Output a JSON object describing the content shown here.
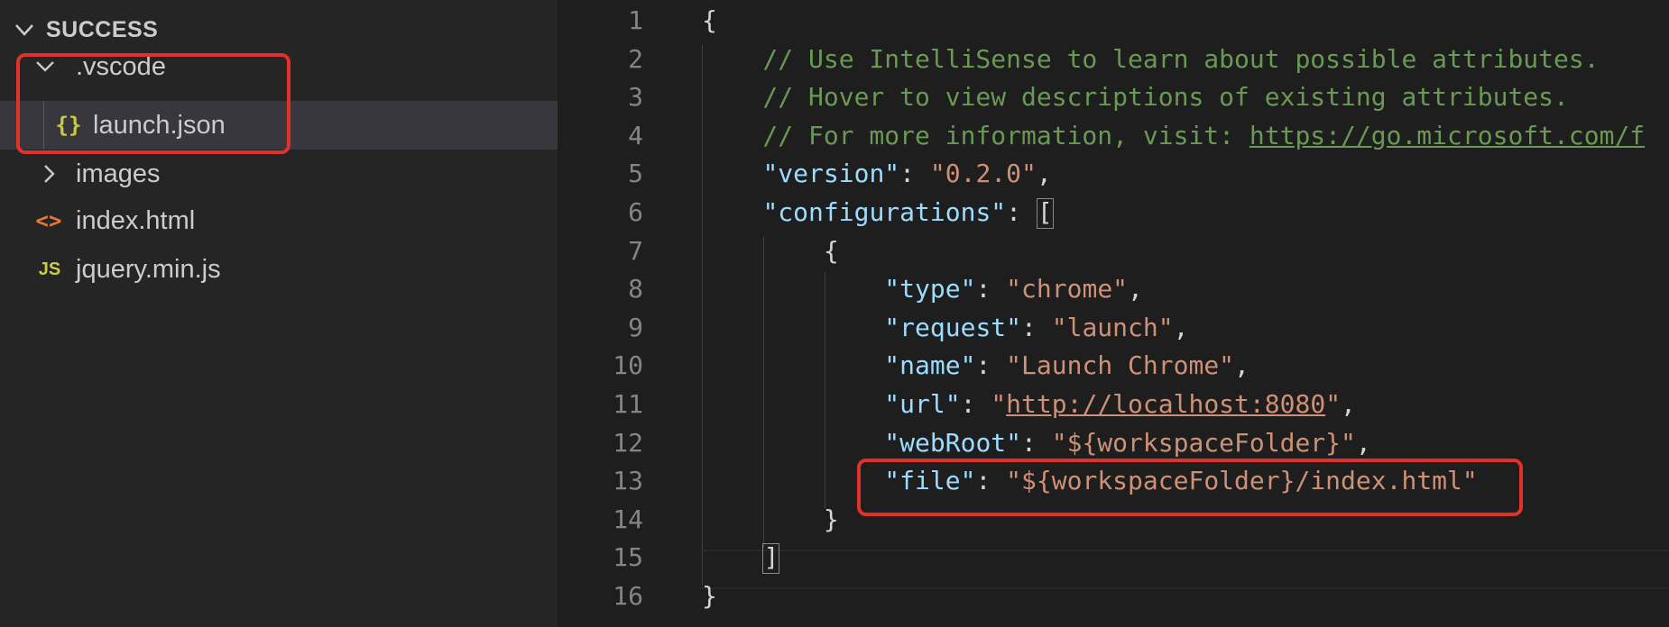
{
  "explorer": {
    "folder_name": "SUCCESS",
    "items": [
      {
        "label": ".vscode",
        "icon": "chevron-down-icon",
        "type": "folder-open"
      },
      {
        "label": "launch.json",
        "icon": "json-braces-icon",
        "icon_glyph": "{}",
        "type": "file",
        "selected": true
      },
      {
        "label": "images",
        "icon": "chevron-right-icon",
        "type": "folder-closed"
      },
      {
        "label": "index.html",
        "icon": "html-brackets-icon",
        "icon_glyph": "<>",
        "type": "file"
      },
      {
        "label": "jquery.min.js",
        "icon": "js-file-icon",
        "icon_glyph": "JS",
        "type": "file"
      }
    ]
  },
  "editor": {
    "lines": [
      {
        "n": "1",
        "segments": [
          {
            "t": "{",
            "c": "pun"
          }
        ]
      },
      {
        "n": "2",
        "segments": [
          {
            "t": "    // Use IntelliSense to learn about possible attributes.",
            "c": "com"
          }
        ]
      },
      {
        "n": "3",
        "segments": [
          {
            "t": "    // Hover to view descriptions of existing attributes.",
            "c": "com"
          }
        ]
      },
      {
        "n": "4",
        "segments": [
          {
            "t": "    // For more information, visit: ",
            "c": "com"
          },
          {
            "t": "https://go.microsoft.com/f",
            "c": "com link"
          }
        ]
      },
      {
        "n": "5",
        "segments": [
          {
            "t": "    ",
            "c": "pun"
          },
          {
            "t": "\"version\"",
            "c": "key"
          },
          {
            "t": ": ",
            "c": "pun"
          },
          {
            "t": "\"0.2.0\"",
            "c": "str"
          },
          {
            "t": ",",
            "c": "pun"
          }
        ]
      },
      {
        "n": "6",
        "segments": [
          {
            "t": "    ",
            "c": "pun"
          },
          {
            "t": "\"configurations\"",
            "c": "key"
          },
          {
            "t": ": ",
            "c": "pun"
          },
          {
            "t": "[",
            "c": "pun box"
          }
        ]
      },
      {
        "n": "7",
        "segments": [
          {
            "t": "        {",
            "c": "pun"
          }
        ]
      },
      {
        "n": "8",
        "segments": [
          {
            "t": "            ",
            "c": "pun"
          },
          {
            "t": "\"type\"",
            "c": "key"
          },
          {
            "t": ": ",
            "c": "pun"
          },
          {
            "t": "\"chrome\"",
            "c": "str"
          },
          {
            "t": ",",
            "c": "pun"
          }
        ]
      },
      {
        "n": "9",
        "segments": [
          {
            "t": "            ",
            "c": "pun"
          },
          {
            "t": "\"request\"",
            "c": "key"
          },
          {
            "t": ": ",
            "c": "pun"
          },
          {
            "t": "\"launch\"",
            "c": "str"
          },
          {
            "t": ",",
            "c": "pun"
          }
        ]
      },
      {
        "n": "10",
        "segments": [
          {
            "t": "            ",
            "c": "pun"
          },
          {
            "t": "\"name\"",
            "c": "key"
          },
          {
            "t": ": ",
            "c": "pun"
          },
          {
            "t": "\"Launch Chrome\"",
            "c": "str"
          },
          {
            "t": ",",
            "c": "pun"
          }
        ]
      },
      {
        "n": "11",
        "segments": [
          {
            "t": "            ",
            "c": "pun"
          },
          {
            "t": "\"url\"",
            "c": "key"
          },
          {
            "t": ": ",
            "c": "pun"
          },
          {
            "t": "\"",
            "c": "str"
          },
          {
            "t": "http://localhost:8080",
            "c": "str link"
          },
          {
            "t": "\"",
            "c": "str"
          },
          {
            "t": ",",
            "c": "pun"
          }
        ]
      },
      {
        "n": "12",
        "segments": [
          {
            "t": "            ",
            "c": "pun"
          },
          {
            "t": "\"webRoot\"",
            "c": "key"
          },
          {
            "t": ": ",
            "c": "pun"
          },
          {
            "t": "\"${workspaceFolder}\"",
            "c": "str"
          },
          {
            "t": ",",
            "c": "pun"
          }
        ]
      },
      {
        "n": "13",
        "segments": [
          {
            "t": "            ",
            "c": "pun"
          },
          {
            "t": "\"file\"",
            "c": "key"
          },
          {
            "t": ": ",
            "c": "pun"
          },
          {
            "t": "\"${workspaceFolder}/index.html\"",
            "c": "str"
          }
        ]
      },
      {
        "n": "14",
        "segments": [
          {
            "t": "        }",
            "c": "pun"
          }
        ]
      },
      {
        "n": "15",
        "segments": [
          {
            "t": "    ",
            "c": "pun"
          },
          {
            "t": "]",
            "c": "pun box"
          }
        ]
      },
      {
        "n": "16",
        "segments": [
          {
            "t": "}",
            "c": "pun"
          }
        ]
      }
    ]
  },
  "colors": {
    "highlight_box": "#e0312b",
    "json_key": "#9cdcfe",
    "json_string": "#ce9178",
    "comment": "#6a9955"
  }
}
